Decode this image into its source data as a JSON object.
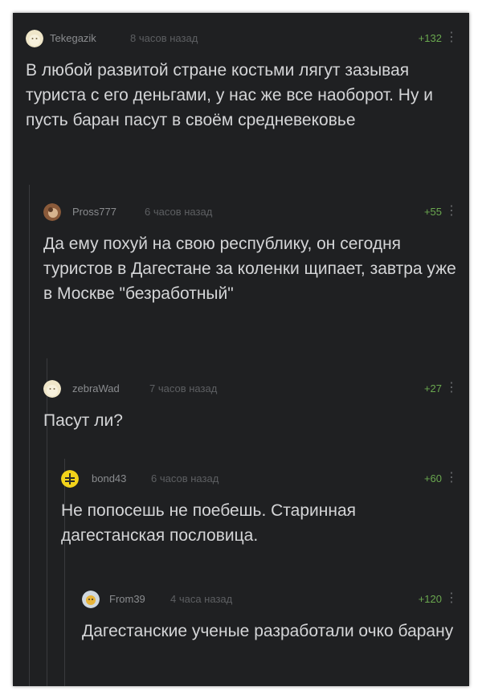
{
  "comments": [
    {
      "author": "Tekegazik",
      "time": "8 часов назад",
      "rating": "+132",
      "text": "В любой развитой стране костьми лягут зазывая туриста с его деньгами, у нас же все наоборот. Ну и пусть баран пасут в своём средневековье"
    },
    {
      "author": "Pross777",
      "time": "6 часов назад",
      "rating": "+55",
      "text": "Да ему похуй на свою республику, он сегодня туристов в Дагестане за коленки щипает, завтра уже в Москве \"безработный\""
    },
    {
      "author": "zebraWad",
      "time": "7 часов назад",
      "rating": "+27",
      "text": "Пасут ли?"
    },
    {
      "author": "bond43",
      "time": "6 часов назад",
      "rating": "+60",
      "text": "Не попосешь не поебешь. Старинная дагестанская пословица."
    },
    {
      "author": "From39",
      "time": "4 часа назад",
      "rating": "+120",
      "text": "Дагестанские ученые разработали очко барану"
    }
  ],
  "more_glyph": "⋮"
}
